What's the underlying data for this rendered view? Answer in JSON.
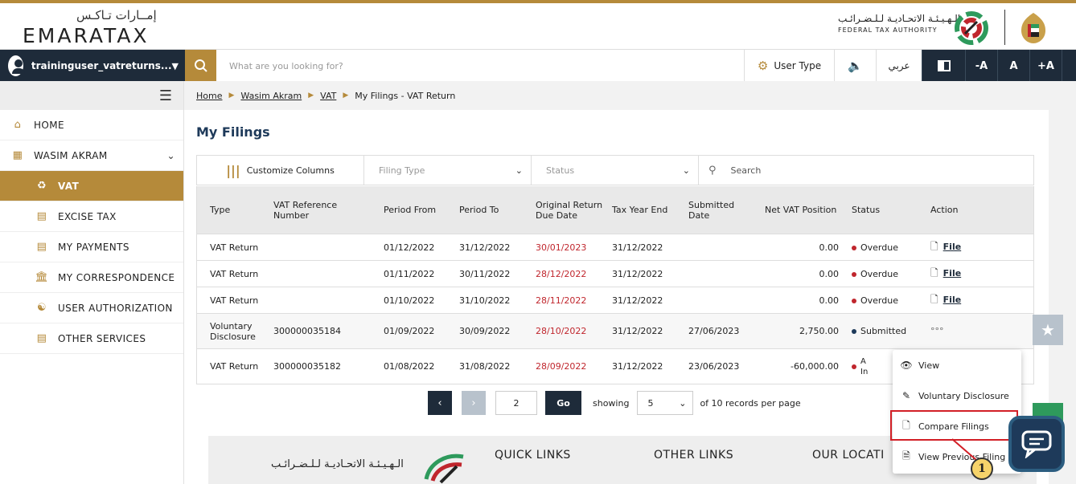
{
  "header": {
    "logo_ar": "إمــارات تـاكـس",
    "logo_en": "EMARATAX",
    "fta_ar": "الـهـيـئـة الاتحـاديـة لـلـضـرائـب",
    "fta_en": "FEDERAL TAX AUTHORITY"
  },
  "navbar": {
    "username": "traininguser_vatreturns...",
    "search_placeholder": "What are you looking for?",
    "user_type": "User Type",
    "lang": "عربي",
    "font_minus": "-A",
    "font_normal": "A",
    "font_plus": "+A"
  },
  "sidebar": {
    "items": [
      {
        "label": "HOME",
        "icon": "home-icon"
      },
      {
        "label": "WASIM AKRAM",
        "icon": "grid-icon"
      },
      {
        "label": "VAT",
        "icon": "money-bag-icon"
      },
      {
        "label": "EXCISE TAX",
        "icon": "excise-icon"
      },
      {
        "label": "MY PAYMENTS",
        "icon": "payment-icon"
      },
      {
        "label": "MY CORRESPONDENCE",
        "icon": "bank-icon"
      },
      {
        "label": "USER AUTHORIZATION",
        "icon": "user-auth-icon"
      },
      {
        "label": "OTHER SERVICES",
        "icon": "clipboard-icon"
      }
    ]
  },
  "breadcrumb": {
    "home": "Home",
    "user": "Wasim Akram",
    "vat": "VAT",
    "current": "My Filings - VAT Return"
  },
  "page": {
    "title": "My Filings"
  },
  "filters": {
    "customize": "Customize Columns",
    "filing_type": "Filing Type",
    "status": "Status",
    "search": "Search"
  },
  "table": {
    "headers": [
      "Type",
      "VAT Reference Number",
      "Period From",
      "Period To",
      "Original Return Due Date",
      "Tax Year End",
      "Submitted Date",
      "Net VAT Position",
      "Status",
      "Action"
    ],
    "rows": [
      {
        "type": "VAT Return",
        "ref": "",
        "from": "01/12/2022",
        "to": "31/12/2022",
        "due": "30/01/2023",
        "tye": "31/12/2022",
        "submitted": "",
        "net": "0.00",
        "status": "Overdue",
        "action": "File"
      },
      {
        "type": "VAT Return",
        "ref": "",
        "from": "01/11/2022",
        "to": "30/11/2022",
        "due": "28/12/2022",
        "tye": "31/12/2022",
        "submitted": "",
        "net": "0.00",
        "status": "Overdue",
        "action": "File"
      },
      {
        "type": "VAT Return",
        "ref": "",
        "from": "01/10/2022",
        "to": "31/10/2022",
        "due": "28/11/2022",
        "tye": "31/12/2022",
        "submitted": "",
        "net": "0.00",
        "status": "Overdue",
        "action": "File"
      },
      {
        "type": "Voluntary Disclosure",
        "ref": "300000035184",
        "from": "01/09/2022",
        "to": "30/09/2022",
        "due": "28/10/2022",
        "tye": "31/12/2022",
        "submitted": "27/06/2023",
        "net": "2,750.00",
        "status": "Submitted",
        "action": "°°°"
      },
      {
        "type": "VAT Return",
        "ref": "300000035182",
        "from": "01/08/2022",
        "to": "31/08/2022",
        "due": "28/09/2022",
        "tye": "31/12/2022",
        "submitted": "23/06/2023",
        "net": "-60,000.00",
        "status": "A\nIn",
        "action": ""
      }
    ]
  },
  "pagination": {
    "prev": "‹",
    "next": "›",
    "page": "2",
    "go": "Go",
    "showing": "showing",
    "per_page": "5",
    "suffix": "of 10 records per page"
  },
  "footer": {
    "fta_ar": "الـهـيـئـة الاتحـاديـة لـلـضـرائـب",
    "quick": "QUICK LINKS",
    "other": "OTHER LINKS",
    "location": "OUR LOCATI"
  },
  "menu": {
    "view": "View",
    "voluntary": "Voluntary Disclosure",
    "compare": "Compare Filings",
    "previous": "View Previous Filing"
  },
  "callout": "1",
  "colors": {
    "gold": "#b58a3a",
    "navy": "#1e2b3a",
    "red": "#c0262d",
    "highlight": "#d21f26"
  }
}
